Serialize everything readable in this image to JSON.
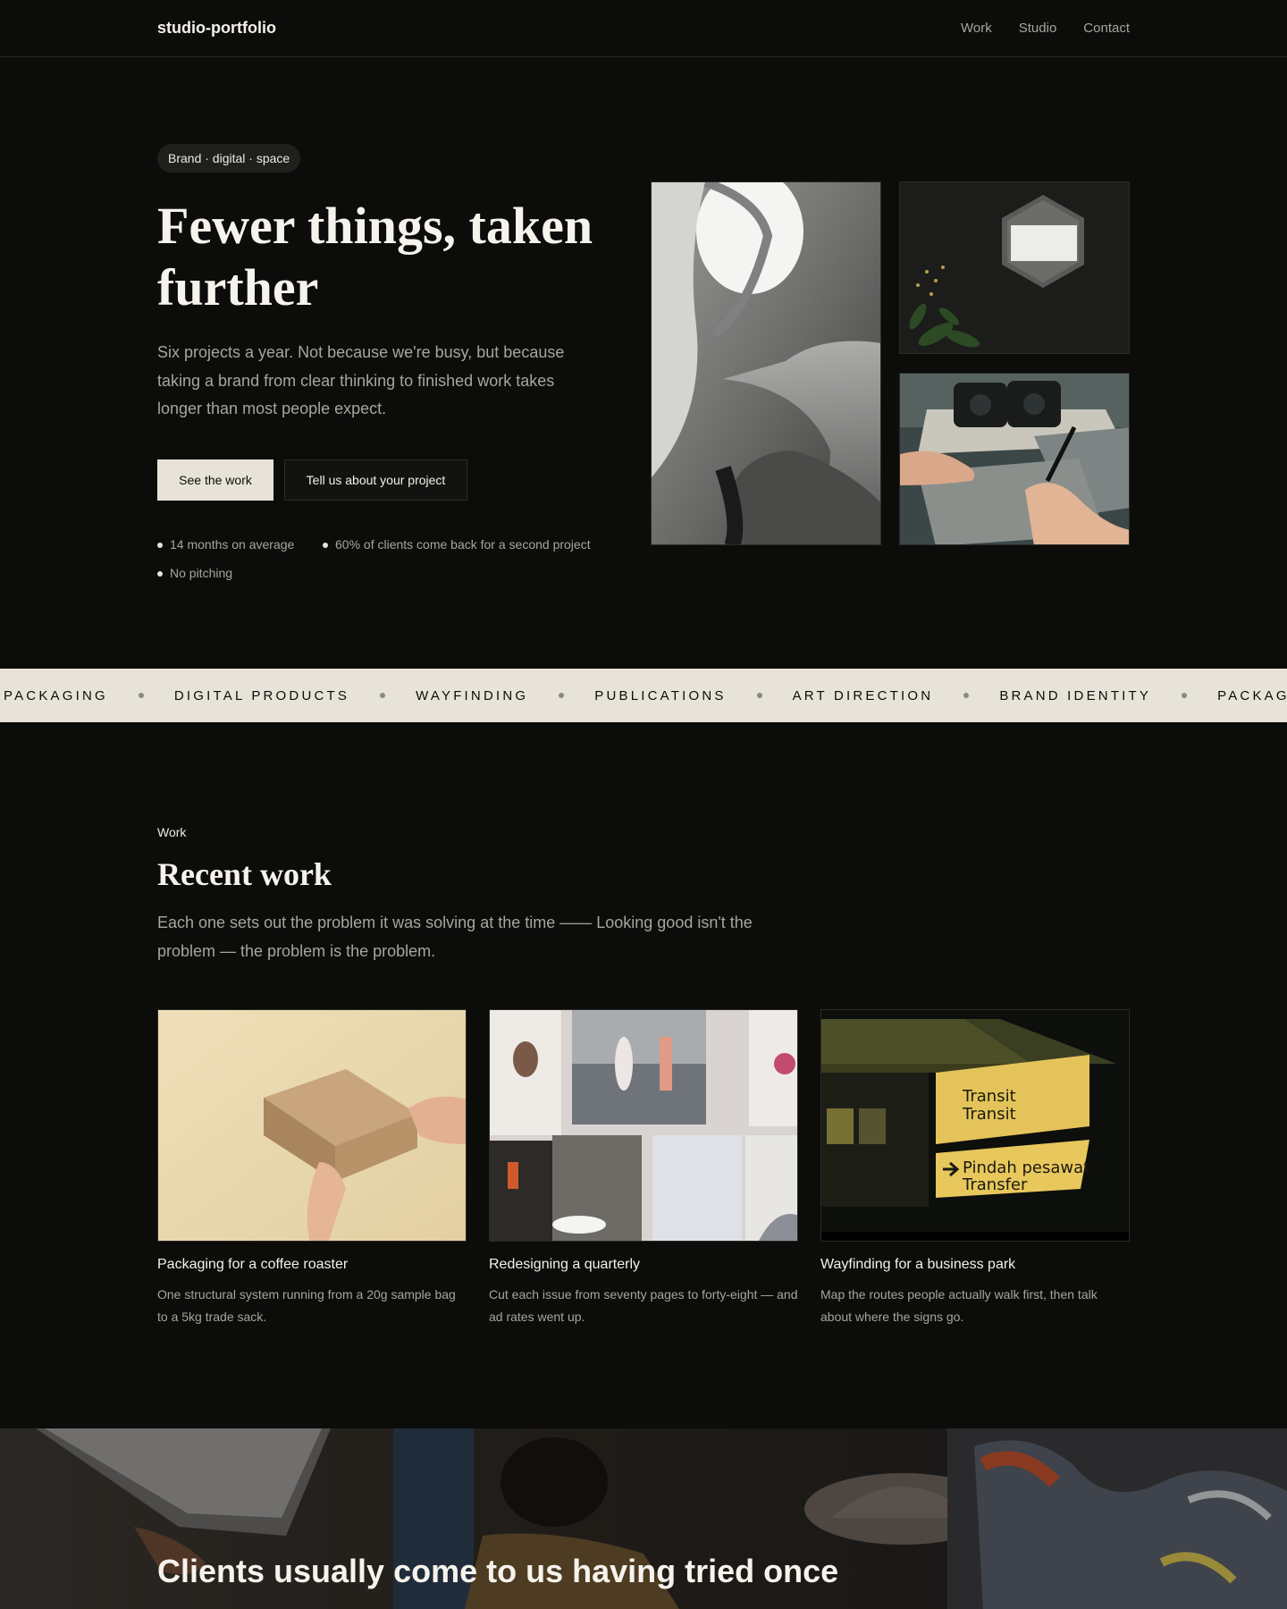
{
  "nav": {
    "brand": "studio-portfolio",
    "links": [
      "Work",
      "Studio",
      "Contact"
    ]
  },
  "hero": {
    "pill": "Brand · digital · space",
    "title": "Fewer things, taken further",
    "lead": "Six projects a year. Not because we're busy, but because taking a brand from clear thinking to finished work takes longer than most people expect.",
    "primary_button": "See the work",
    "secondary_button": "Tell us about your project",
    "stats": [
      "14 months on average",
      "60% of clients come back for a second project",
      "No pitching"
    ]
  },
  "marquee": {
    "items": [
      "PACKAGING",
      "DIGITAL PRODUCTS",
      "WAYFINDING",
      "PUBLICATIONS",
      "ART DIRECTION",
      "BRAND IDENTITY",
      "PACKAGING"
    ]
  },
  "work": {
    "eyebrow": "Work",
    "title": "Recent work",
    "lead": "Each one sets out the problem it was solving at the time —— Looking good isn't the problem — the problem is the problem.",
    "cards": [
      {
        "title": "Packaging for a coffee roaster",
        "desc": "One structural system running from a 20g sample bag to a 5kg trade sack."
      },
      {
        "title": "Redesigning a quarterly",
        "desc": "Cut each issue from seventy pages to forty-eight — and ad rates went up."
      },
      {
        "title": "Wayfinding for a business park",
        "desc": "Map the routes people actually walk first, then talk about where the signs go."
      }
    ],
    "sign_text": [
      "Transit",
      "Transit",
      "Pindah pesawat",
      "Transfer"
    ]
  },
  "banner": {
    "title": "Clients usually come to us having tried once"
  },
  "colors": {
    "background": "#0c0c0b",
    "accent": "#e8e3d8",
    "muted_text": "#a8a59e",
    "heading_text": "#f6f3ec"
  }
}
